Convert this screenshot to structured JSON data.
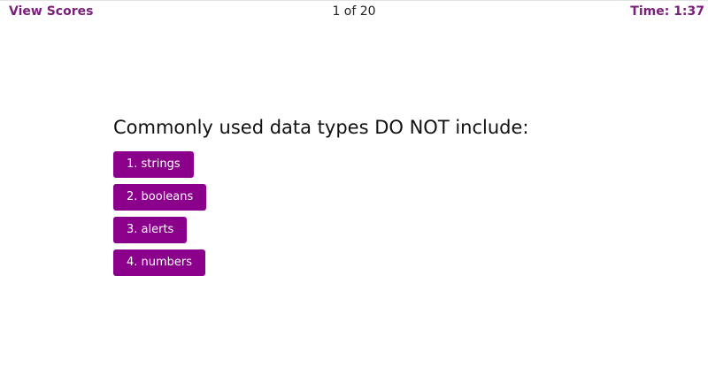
{
  "header": {
    "view_scores_label": "View Scores",
    "progress_text": "1 of 20",
    "timer_text": "Time: 1:37"
  },
  "question": {
    "text": "Commonly used data types DO NOT include:",
    "answers": [
      {
        "label": "1. strings"
      },
      {
        "label": "2. booleans"
      },
      {
        "label": "3. alerts"
      },
      {
        "label": "4. numbers"
      }
    ]
  },
  "colors": {
    "accent_text": "#7a1f7a",
    "button_bg": "#8b008b",
    "button_text": "#ffffff"
  }
}
